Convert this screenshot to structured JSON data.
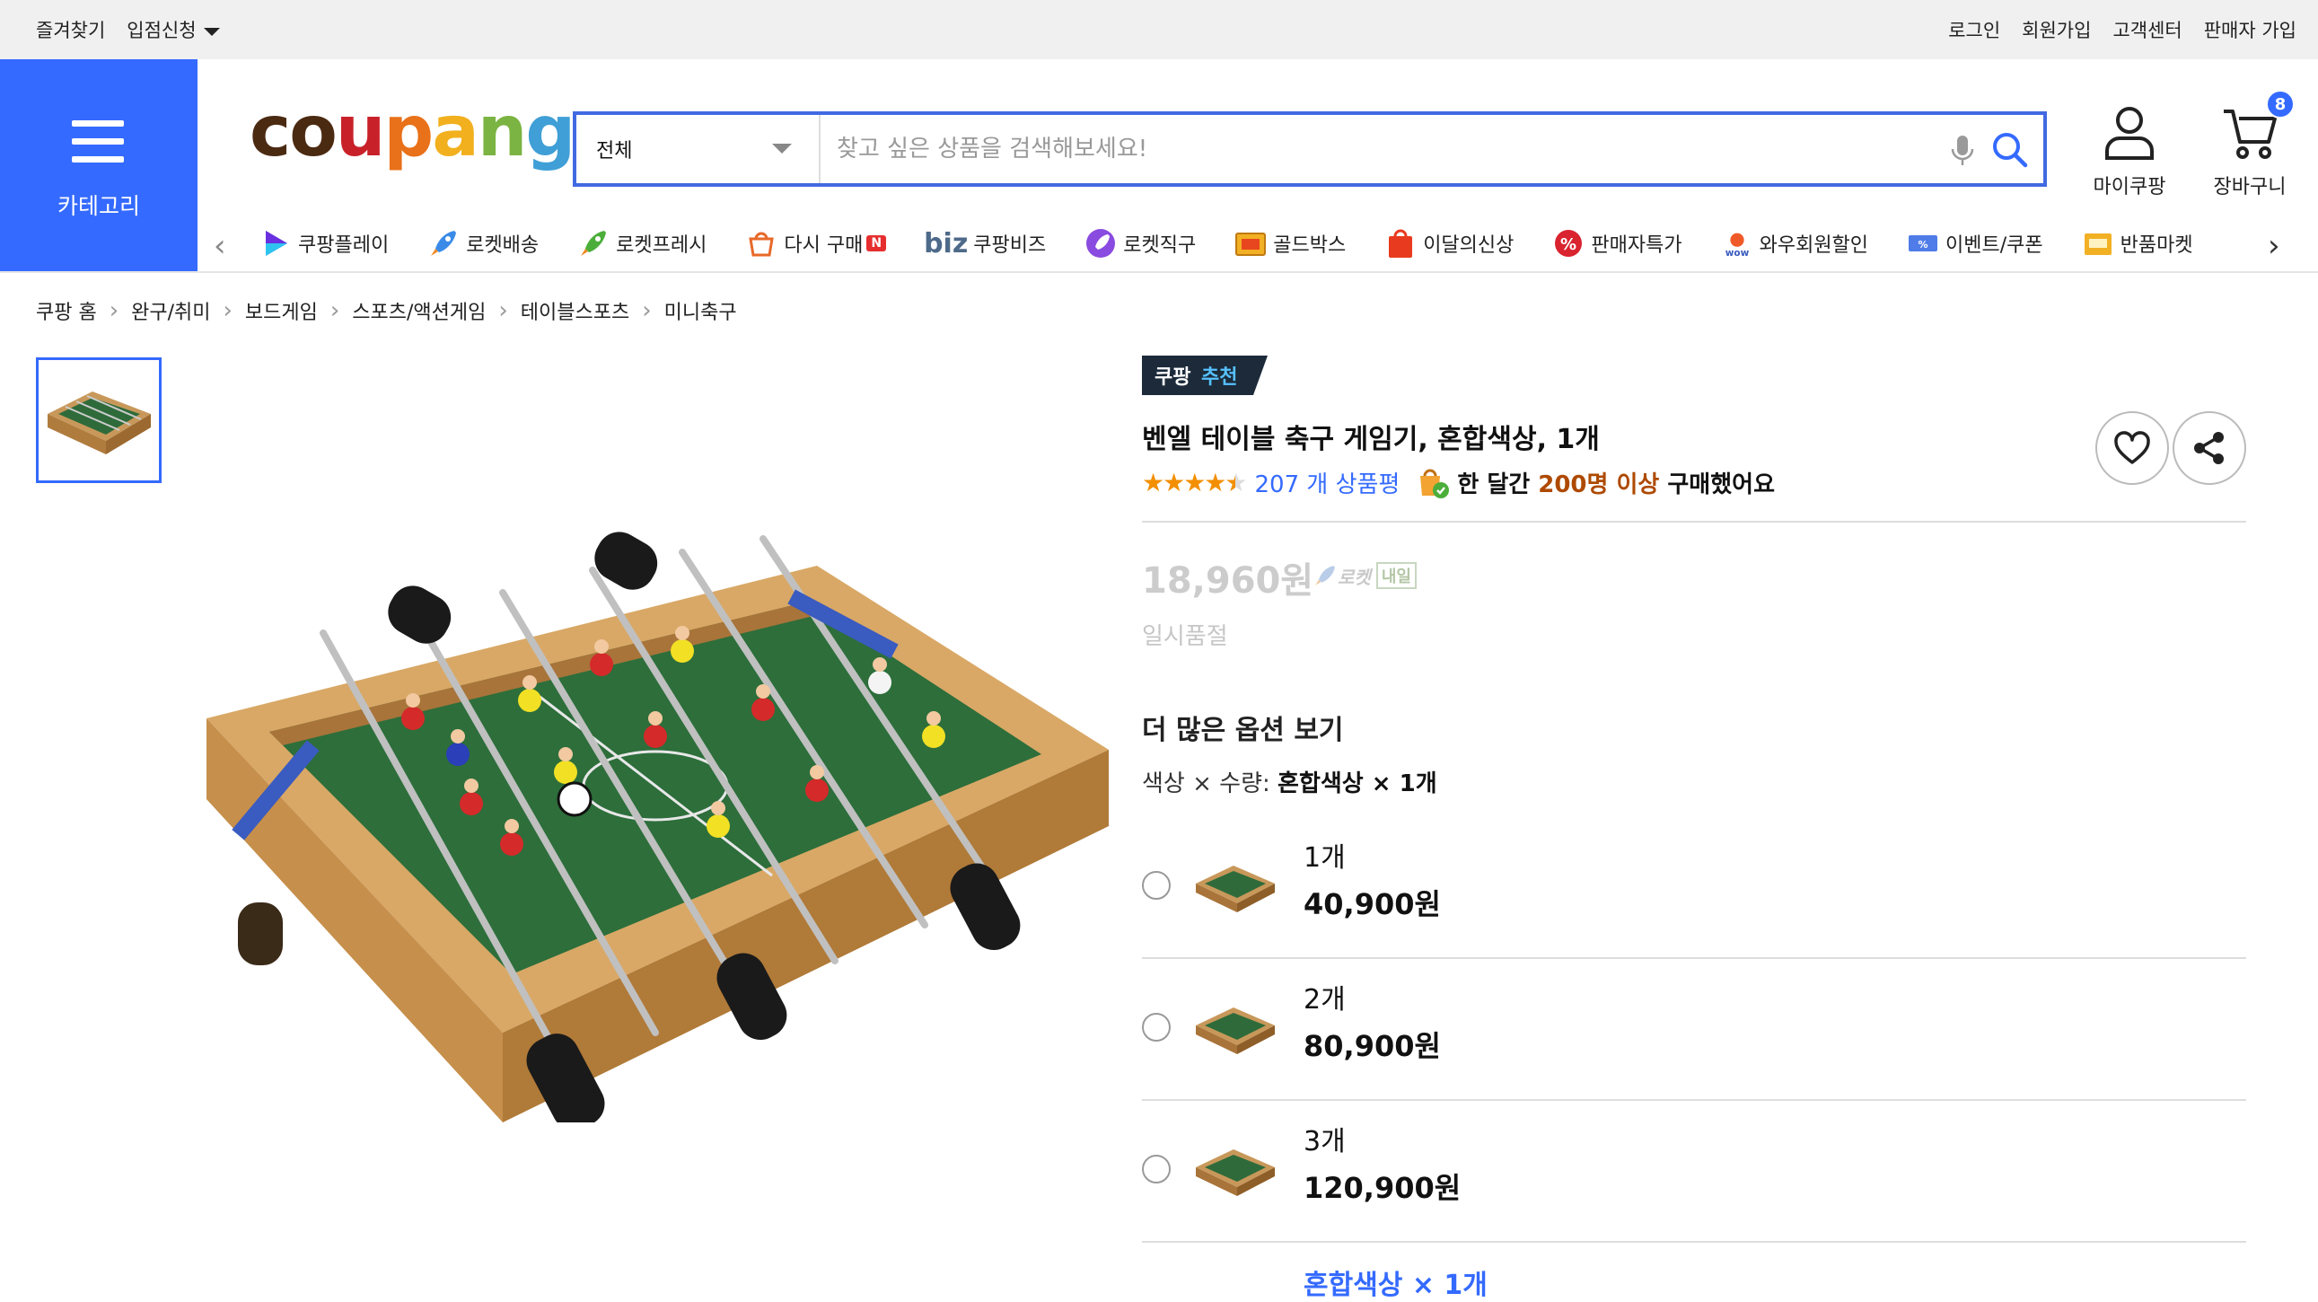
{
  "topbar": {
    "bookmark": "즐겨찾기",
    "partner": "입점신청",
    "login": "로그인",
    "signup": "회원가입",
    "customer_center": "고객센터",
    "seller_signup": "판매자 가입"
  },
  "header": {
    "category_label": "카테고리",
    "logo_text": "coupang",
    "search": {
      "category_value": "전체",
      "placeholder": "찾고 싶은 상품을 검색해보세요!"
    },
    "my_coupang": "마이쿠팡",
    "cart_label": "장바구니",
    "cart_count": "8"
  },
  "nav": {
    "items": [
      {
        "label": "쿠팡플레이",
        "icon": "play-icon"
      },
      {
        "label": "로켓배송",
        "icon": "rocket-icon"
      },
      {
        "label": "로켓프레시",
        "icon": "rocket-fresh-icon"
      },
      {
        "label": "다시 구매",
        "icon": "rebuy-icon"
      },
      {
        "label": "쿠팡비즈",
        "icon": "biz-icon"
      },
      {
        "label": "로켓직구",
        "icon": "rocket-global-icon"
      },
      {
        "label": "골드박스",
        "icon": "goldbox-icon"
      },
      {
        "label": "이달의신상",
        "icon": "new-icon"
      },
      {
        "label": "판매자특가",
        "icon": "seller-deal-icon"
      },
      {
        "label": "와우회원할인",
        "icon": "wow-icon"
      },
      {
        "label": "이벤트/쿠폰",
        "icon": "coupon-icon"
      },
      {
        "label": "반품마켓",
        "icon": "return-market-icon"
      }
    ],
    "rebuy_badge": "N",
    "biz_prefix": "biz"
  },
  "breadcrumb": [
    "쿠팡 홈",
    "완구/취미",
    "보드게임",
    "스포츠/액션게임",
    "테이블스포츠",
    "미니축구"
  ],
  "product": {
    "badge_left": "쿠팡",
    "badge_right": "추천",
    "title": "벤엘 테이블 축구 게임기, 혼합색상, 1개",
    "rating": 4.5,
    "review_text": "207 개 상품평",
    "bought_prefix": "한 달간",
    "bought_highlight": "200명 이상",
    "bought_suffix": "구매했어요",
    "price": "18,960원",
    "rocket_label": "로켓",
    "rocket_tag": "내일",
    "status": "일시품절",
    "more_options_title": "더 많은 옵션 보기",
    "option_label": "색상 × 수량:",
    "option_value": "혼합색상 × 1개",
    "options": [
      {
        "qty": "1개",
        "price": "40,900원"
      },
      {
        "qty": "2개",
        "price": "80,900원"
      },
      {
        "qty": "3개",
        "price": "120,900원"
      }
    ],
    "next_option": "혼합색상 × 1개"
  },
  "colors": {
    "brand_blue": "#346aff",
    "search_border": "#4169e1",
    "star": "#f38f00",
    "bought_highlight": "#ae4a00"
  }
}
